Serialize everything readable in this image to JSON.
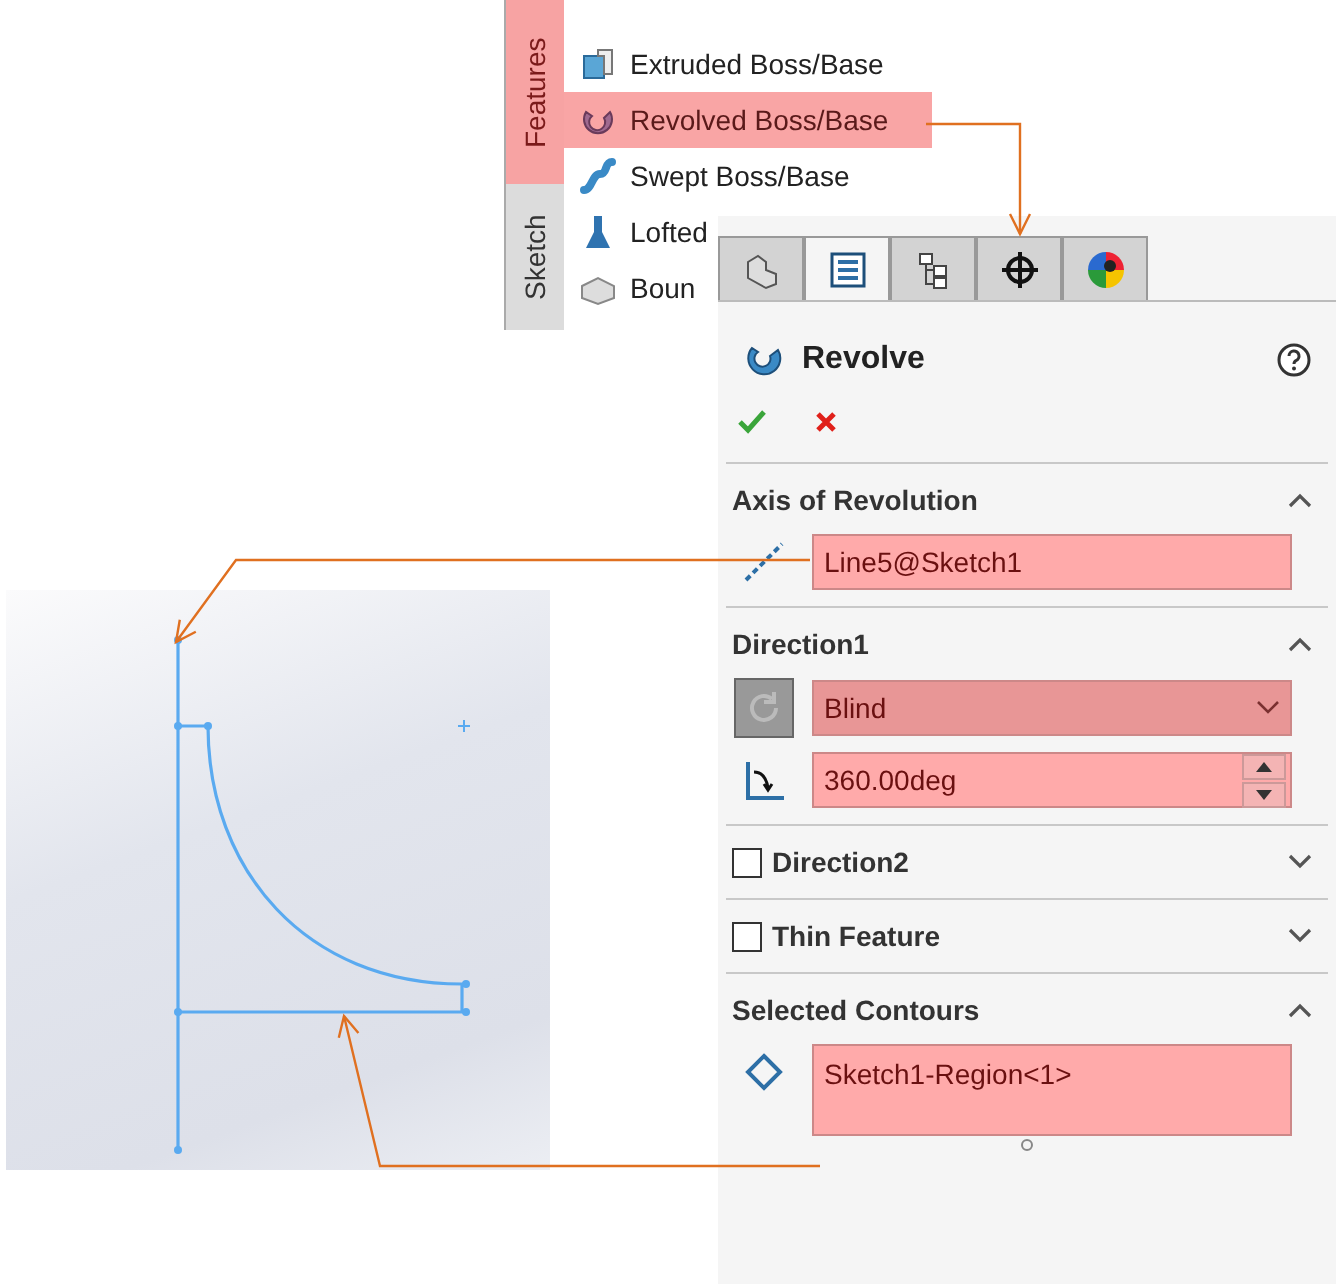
{
  "feature_menu": {
    "tabs": [
      {
        "label": "Features",
        "selected": true
      },
      {
        "label": "Sketch",
        "selected": false
      }
    ],
    "items": [
      {
        "kind": "extrude",
        "label": "Extruded Boss/Base",
        "selected": false
      },
      {
        "kind": "revolve",
        "label": "Revolved Boss/Base",
        "selected": true
      },
      {
        "kind": "sweep",
        "label": "Swept Boss/Base",
        "selected": false
      },
      {
        "kind": "loft",
        "label": "Lofted",
        "selected": false
      },
      {
        "kind": "boundary",
        "label": "Boun",
        "selected": false
      }
    ]
  },
  "property_manager": {
    "tabs": [
      {
        "kind": "feature",
        "selected": false
      },
      {
        "kind": "property",
        "selected": true
      },
      {
        "kind": "config",
        "selected": false
      },
      {
        "kind": "dimxpert",
        "selected": false
      },
      {
        "kind": "display",
        "selected": false
      }
    ],
    "title": "Revolve",
    "sections": [
      {
        "kind": "axis",
        "title": "Axis of Revolution",
        "expanded": true,
        "value": "Line5@Sketch1"
      },
      {
        "kind": "direction",
        "title": "Direction1",
        "expanded": true,
        "end_condition": "Blind",
        "angle": "360.00deg"
      },
      {
        "kind": "option",
        "title": "Direction2",
        "checked": false,
        "expanded": false
      },
      {
        "kind": "option",
        "title": "Thin Feature",
        "checked": false,
        "expanded": false
      },
      {
        "kind": "contours",
        "title": "Selected Contours",
        "expanded": true,
        "value": "Sketch1-Region<1>"
      }
    ]
  }
}
